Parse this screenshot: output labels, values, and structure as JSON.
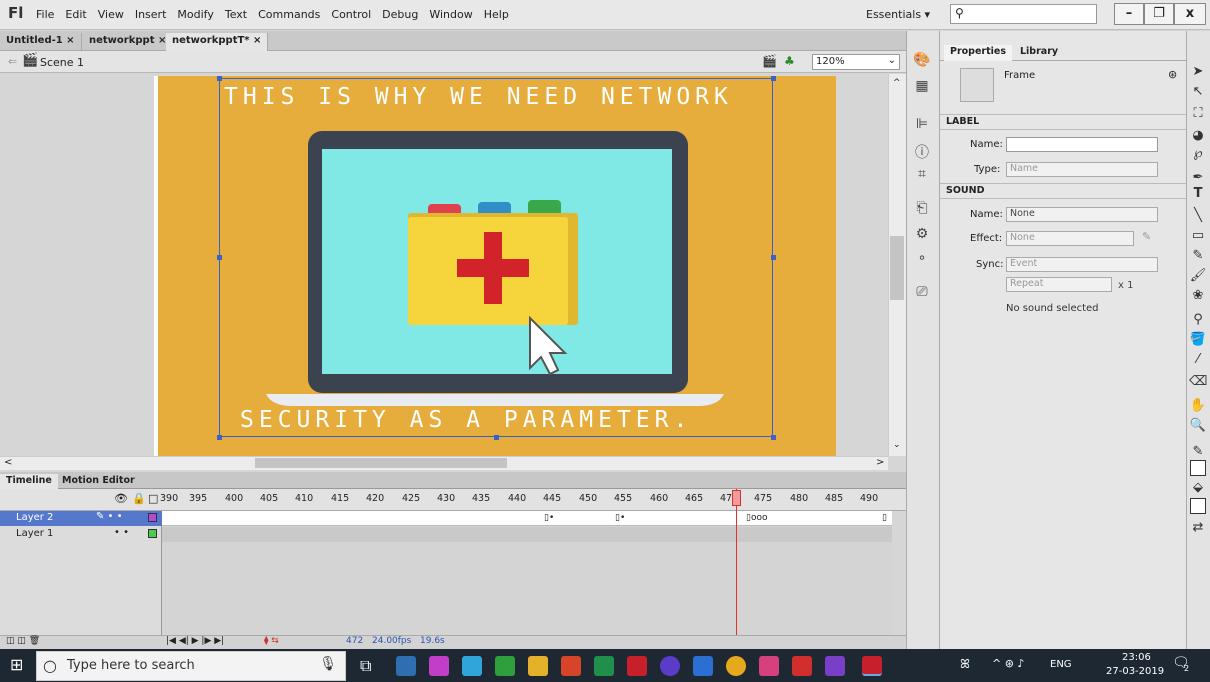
{
  "app": {
    "logo": "Fl",
    "menus": [
      "File",
      "Edit",
      "View",
      "Insert",
      "Modify",
      "Text",
      "Commands",
      "Control",
      "Debug",
      "Window",
      "Help"
    ],
    "workspace": "Essentials ▾"
  },
  "window_controls": {
    "minimize": "–",
    "restore": "❐",
    "close": "x"
  },
  "doc_tabs": [
    {
      "label": "Untitled-1 ×"
    },
    {
      "label": "networkppt ×"
    },
    {
      "label": "networkpptT* ×"
    }
  ],
  "scene": {
    "label": "Scene 1",
    "zoom": "120%"
  },
  "stage": {
    "line1": "THIS IS WHY WE NEED NETWORK",
    "line2": "SECURITY AS A PARAMETER."
  },
  "timeline": {
    "tabs": [
      "Timeline",
      "Motion Editor"
    ],
    "frame_numbers": [
      "390",
      "395",
      "400",
      "405",
      "410",
      "415",
      "420",
      "425",
      "430",
      "435",
      "440",
      "445",
      "450",
      "455",
      "460",
      "465",
      "470",
      "475",
      "480",
      "485",
      "490"
    ],
    "layers": [
      {
        "name": "Layer 2",
        "color": "#b04dd6"
      },
      {
        "name": "Layer 1",
        "color": "#4ccc4c"
      }
    ],
    "footer": {
      "frame": "472",
      "fps": "24.00fps",
      "time": "19.6s"
    }
  },
  "properties": {
    "tabs": [
      "Properties",
      "Library"
    ],
    "header": "Frame",
    "label_section": "LABEL",
    "name_label": "Name:",
    "type_label": "Type:",
    "type_value": "Name",
    "sound_section": "SOUND",
    "sound_name_label": "Name:",
    "sound_name_value": "None",
    "effect_label": "Effect:",
    "effect_value": "None",
    "sync_label": "Sync:",
    "sync_value": "Event",
    "repeat_value": "Repeat",
    "repeat_count": "x 1",
    "status": "No sound selected"
  },
  "taskbar": {
    "search_placeholder": "Type here to search",
    "lang": "ENG",
    "time": "23:06",
    "date": "27-03-2019",
    "notifications": "2"
  },
  "colors": {
    "artboard": "#e7ad3c",
    "screen": "#80e8e5",
    "folder": "#f5d53b",
    "cross": "#d2232a"
  }
}
